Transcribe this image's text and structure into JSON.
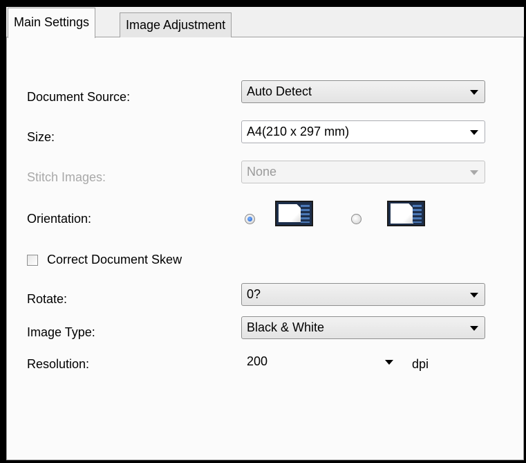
{
  "tabs": [
    {
      "label": "Main Settings",
      "active": true
    },
    {
      "label": "Image Adjustment",
      "active": false
    }
  ],
  "document_source": {
    "label": "Document Source:",
    "value": "Auto Detect"
  },
  "size": {
    "label": "Size:",
    "value": "A4(210 x 297 mm)"
  },
  "stitch_images": {
    "label": "Stitch Images:",
    "value": "None",
    "disabled": true
  },
  "orientation": {
    "label": "Orientation:",
    "options": [
      {
        "name": "portrait",
        "selected": true,
        "icon": "portrait-orientation-icon"
      },
      {
        "name": "landscape",
        "selected": false,
        "icon": "landscape-orientation-icon"
      }
    ]
  },
  "correct_skew": {
    "label": "Correct Document Skew",
    "checked": false
  },
  "rotate": {
    "label": "Rotate:",
    "value": "0?"
  },
  "image_type": {
    "label": "Image Type:",
    "value": "Black & White"
  },
  "resolution": {
    "label": "Resolution:",
    "value": "200",
    "unit": "dpi"
  },
  "colors": {
    "selection_accent": "#1d5bc7",
    "disabled_text": "#a9a9a9"
  }
}
